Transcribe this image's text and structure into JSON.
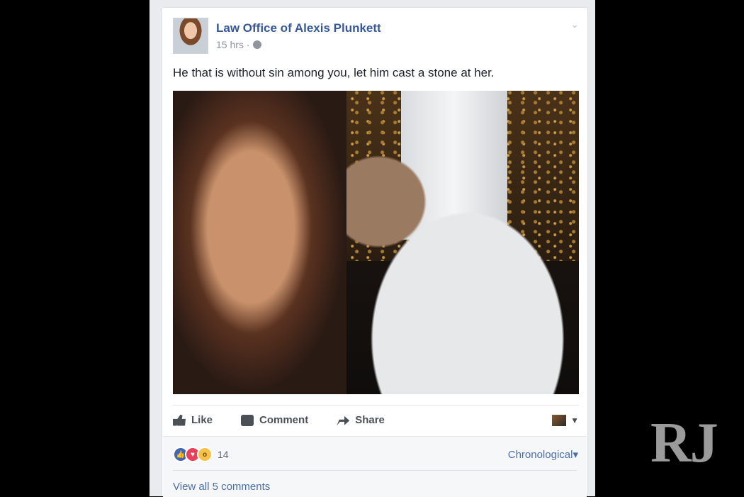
{
  "post": {
    "author": "Law Office of Alexis Plunkett",
    "time": "15 hrs",
    "separator": "·",
    "text": "He that is without sin among you, let him cast a stone at her."
  },
  "actions": {
    "like": "Like",
    "comment": "Comment",
    "share": "Share"
  },
  "reactions": {
    "count": "14",
    "order": "Chronological",
    "order_caret": "▾",
    "view_all": "View all 5 comments"
  },
  "watermark": "RJ",
  "colors": {
    "link": "#365899",
    "reaction_like": "#4267b2",
    "reaction_love": "#e9405a",
    "reaction_wow": "#f7c14a"
  }
}
